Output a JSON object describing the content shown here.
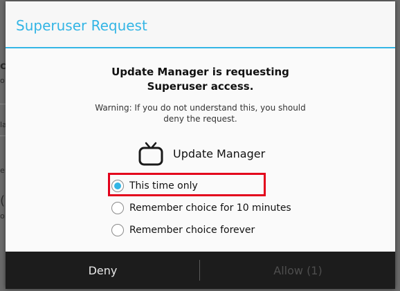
{
  "background": {
    "fragments": [
      "ch",
      "o",
      "la",
      "e",
      "(",
      "o"
    ]
  },
  "dialog": {
    "title": "Superuser Request",
    "heading_line1": "Update Manager is requesting",
    "heading_line2": "Superuser access.",
    "warning_line1": "Warning: If you do not understand this, you should",
    "warning_line2": "deny the request.",
    "app_name": "Update Manager",
    "app_icon": "tv-icon",
    "options": [
      {
        "label": "This time only",
        "checked": true
      },
      {
        "label": "Remember choice for 10 minutes",
        "checked": false
      },
      {
        "label": "Remember choice forever",
        "checked": false
      }
    ],
    "buttons": {
      "deny": "Deny",
      "allow": "Allow (1)"
    }
  },
  "colors": {
    "accent": "#33b5e5",
    "highlight": "#e3001b",
    "button_bar": "#1c1c1c"
  }
}
